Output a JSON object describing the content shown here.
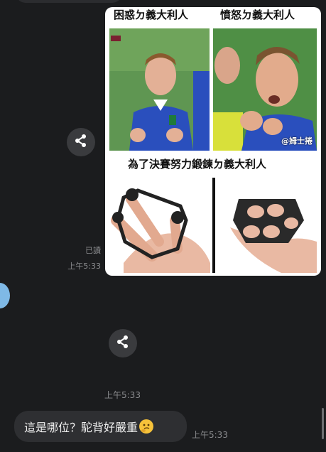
{
  "chat": {
    "read_label": "已讀",
    "time_1": "上午5:33",
    "time_2": "上午5:33",
    "time_3": "上午5:33",
    "incoming_message": "這是哪位？駝背好嚴重"
  },
  "meme": {
    "caption_left": "困惑ㄉ義大利人",
    "caption_right": "憤怒ㄉ義大利人",
    "caption_bottom": "為了決賽努力鍛鍊ㄉ義大利人",
    "watermark": "@姆士捲"
  },
  "icons": {
    "share": "share-icon",
    "emoji": "thinking-face-emoji"
  },
  "colors": {
    "background": "#1b1c1e",
    "bubble": "#2e2f32",
    "share_button": "#3a3b3e"
  }
}
